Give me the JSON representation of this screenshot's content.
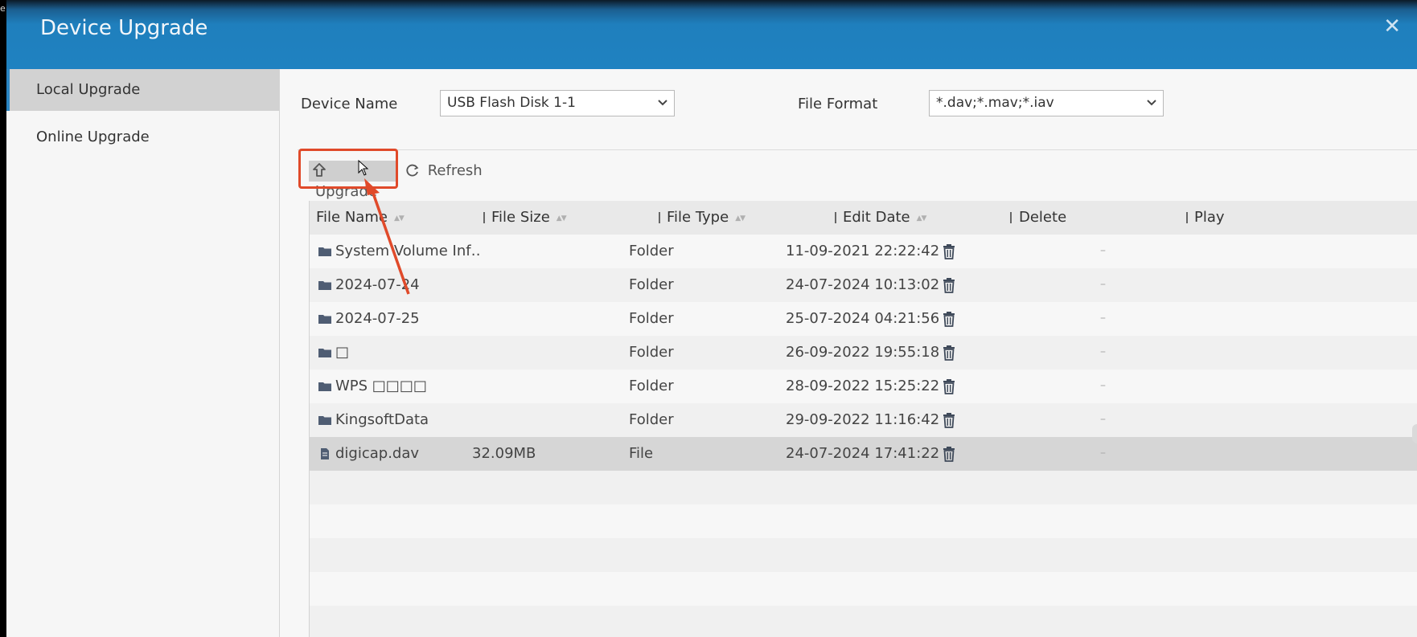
{
  "window": {
    "title": "Device Upgrade",
    "close_glyph": "✕"
  },
  "edge_text": "e",
  "sidebar": {
    "items": [
      {
        "label": "Local Upgrade",
        "active": true
      },
      {
        "label": "Online Upgrade",
        "active": false
      }
    ]
  },
  "form": {
    "device_name_label": "Device Name",
    "device_name_value": "USB Flash Disk 1-1",
    "file_format_label": "File Format",
    "file_format_value": "*.dav;*.mav;*.iav"
  },
  "toolbar": {
    "upgrade_label": "Upgrade",
    "refresh_label": "Refresh"
  },
  "table": {
    "headers": [
      "File Name",
      "File Size",
      "File Type",
      "Edit Date",
      "Delete",
      "Play"
    ],
    "rows": [
      {
        "name": "System Volume Inf…",
        "size": "",
        "type": "Folder",
        "date": "11-09-2021 22:22:42",
        "play": "–"
      },
      {
        "name": "2024-07-24",
        "size": "",
        "type": "Folder",
        "date": "24-07-2024 10:13:02",
        "play": "–"
      },
      {
        "name": "2024-07-25",
        "size": "",
        "type": "Folder",
        "date": "25-07-2024 04:21:56",
        "play": "–"
      },
      {
        "name": "□",
        "size": "",
        "type": "Folder",
        "date": "26-09-2022 19:55:18",
        "play": "–"
      },
      {
        "name": "WPS □□□□",
        "size": "",
        "type": "Folder",
        "date": "28-09-2022 15:25:22",
        "play": "–"
      },
      {
        "name": "KingsoftData",
        "size": "",
        "type": "Folder",
        "date": "29-09-2022 11:16:42",
        "play": "–"
      },
      {
        "name": "digicap.dav",
        "size": "32.09MB",
        "type": "File",
        "date": "24-07-2024 17:41:22",
        "play": "–"
      }
    ]
  },
  "icons": {
    "folder": "folder-icon",
    "file": "file-icon",
    "delete": "trash-icon",
    "upgrade": "upload-arrow-icon",
    "refresh": "refresh-icon",
    "chevron": "chevron-down-icon"
  },
  "colors": {
    "accent": "#1f82c1",
    "annotation": "#e04a2a",
    "selected_row": "#d6d6d6"
  }
}
